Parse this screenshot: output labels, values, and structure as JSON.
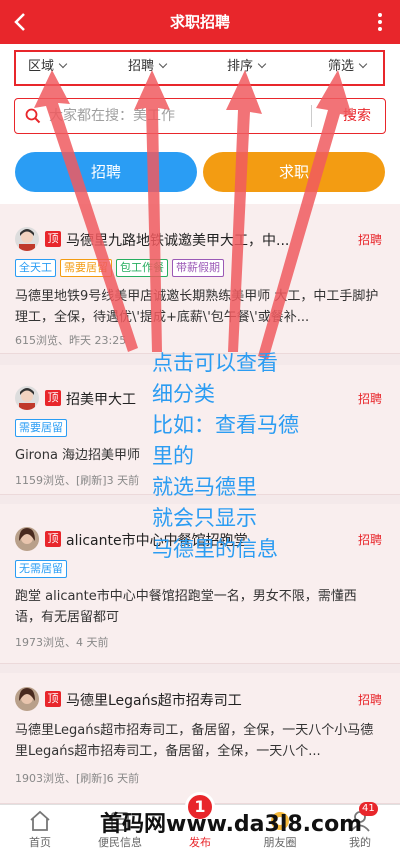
{
  "header": {
    "title": "求职招聘"
  },
  "filters": [
    {
      "label": "区域"
    },
    {
      "label": "招聘"
    },
    {
      "label": "排序"
    },
    {
      "label": "筛选"
    }
  ],
  "search": {
    "placeholder": "大家都在搜：美工作",
    "button_label": "搜索"
  },
  "tabs": {
    "hire_label": "招聘",
    "seek_label": "求职"
  },
  "listings": [
    {
      "top_badge": "顶",
      "title": "马德里九路地铁诚邀美甲大工，中...",
      "type": "招聘",
      "tags": [
        {
          "text": "全天工",
          "color": "#2a9df4"
        },
        {
          "text": "需要居留",
          "color": "#f39c12"
        },
        {
          "text": "包工作餐",
          "color": "#27ae60"
        },
        {
          "text": "带薪假期",
          "color": "#9b59b6"
        }
      ],
      "desc": "马德里地铁9号线美甲店诚邀长期熟练美甲师 大工，中工手脚护理工，全保，待遇优\\'提成+底薪\\'包午餐\\'或餐补...",
      "meta": "615浏览、昨天 23:25"
    },
    {
      "top_badge": "顶",
      "title": "招美甲大工",
      "type": "招聘",
      "tags": [
        {
          "text": "需要居留",
          "color": "#2a9df4"
        }
      ],
      "desc": "Girona 海边招美甲师",
      "meta": "1159浏览、[刷新]3 天前"
    },
    {
      "top_badge": "顶",
      "title": "alicante市中心中餐馆招跑堂",
      "type": "招聘",
      "tags": [
        {
          "text": "无需居留",
          "color": "#2a9df4"
        }
      ],
      "desc": "跑堂 alicante市中心中餐馆招跑堂一名，男女不限，需懂西语，有无居留都可",
      "meta": "1973浏览、4 天前"
    },
    {
      "top_badge": "顶",
      "title": "马德里Legańs超市招寿司工",
      "type": "招聘",
      "tags": [],
      "desc": "马德里Legańs超市招寿司工，备居留，全保，一天八个小马德里Legańs超市招寿司工，备居留，全保，一天八个...",
      "meta": "1903浏览、[刷新]6 天前"
    }
  ],
  "annotation": {
    "lines": [
      "点击可以查看",
      "细分类",
      "比如：查看马德",
      "里的",
      "就选马德里",
      "就会只显示",
      "马德里的信息"
    ]
  },
  "bottom_nav": [
    {
      "label": "首页"
    },
    {
      "label": "便民信息"
    },
    {
      "label": "发布"
    },
    {
      "label": "朋友圈"
    },
    {
      "label": "我的"
    }
  ],
  "publish_badge": "1",
  "message_badge": "41",
  "watermark": "首码网www.da3l8.com",
  "colors": {
    "primary": "#e8262b",
    "blue": "#2a9df4",
    "orange": "#f39c12",
    "note": "#2b9cf2"
  }
}
